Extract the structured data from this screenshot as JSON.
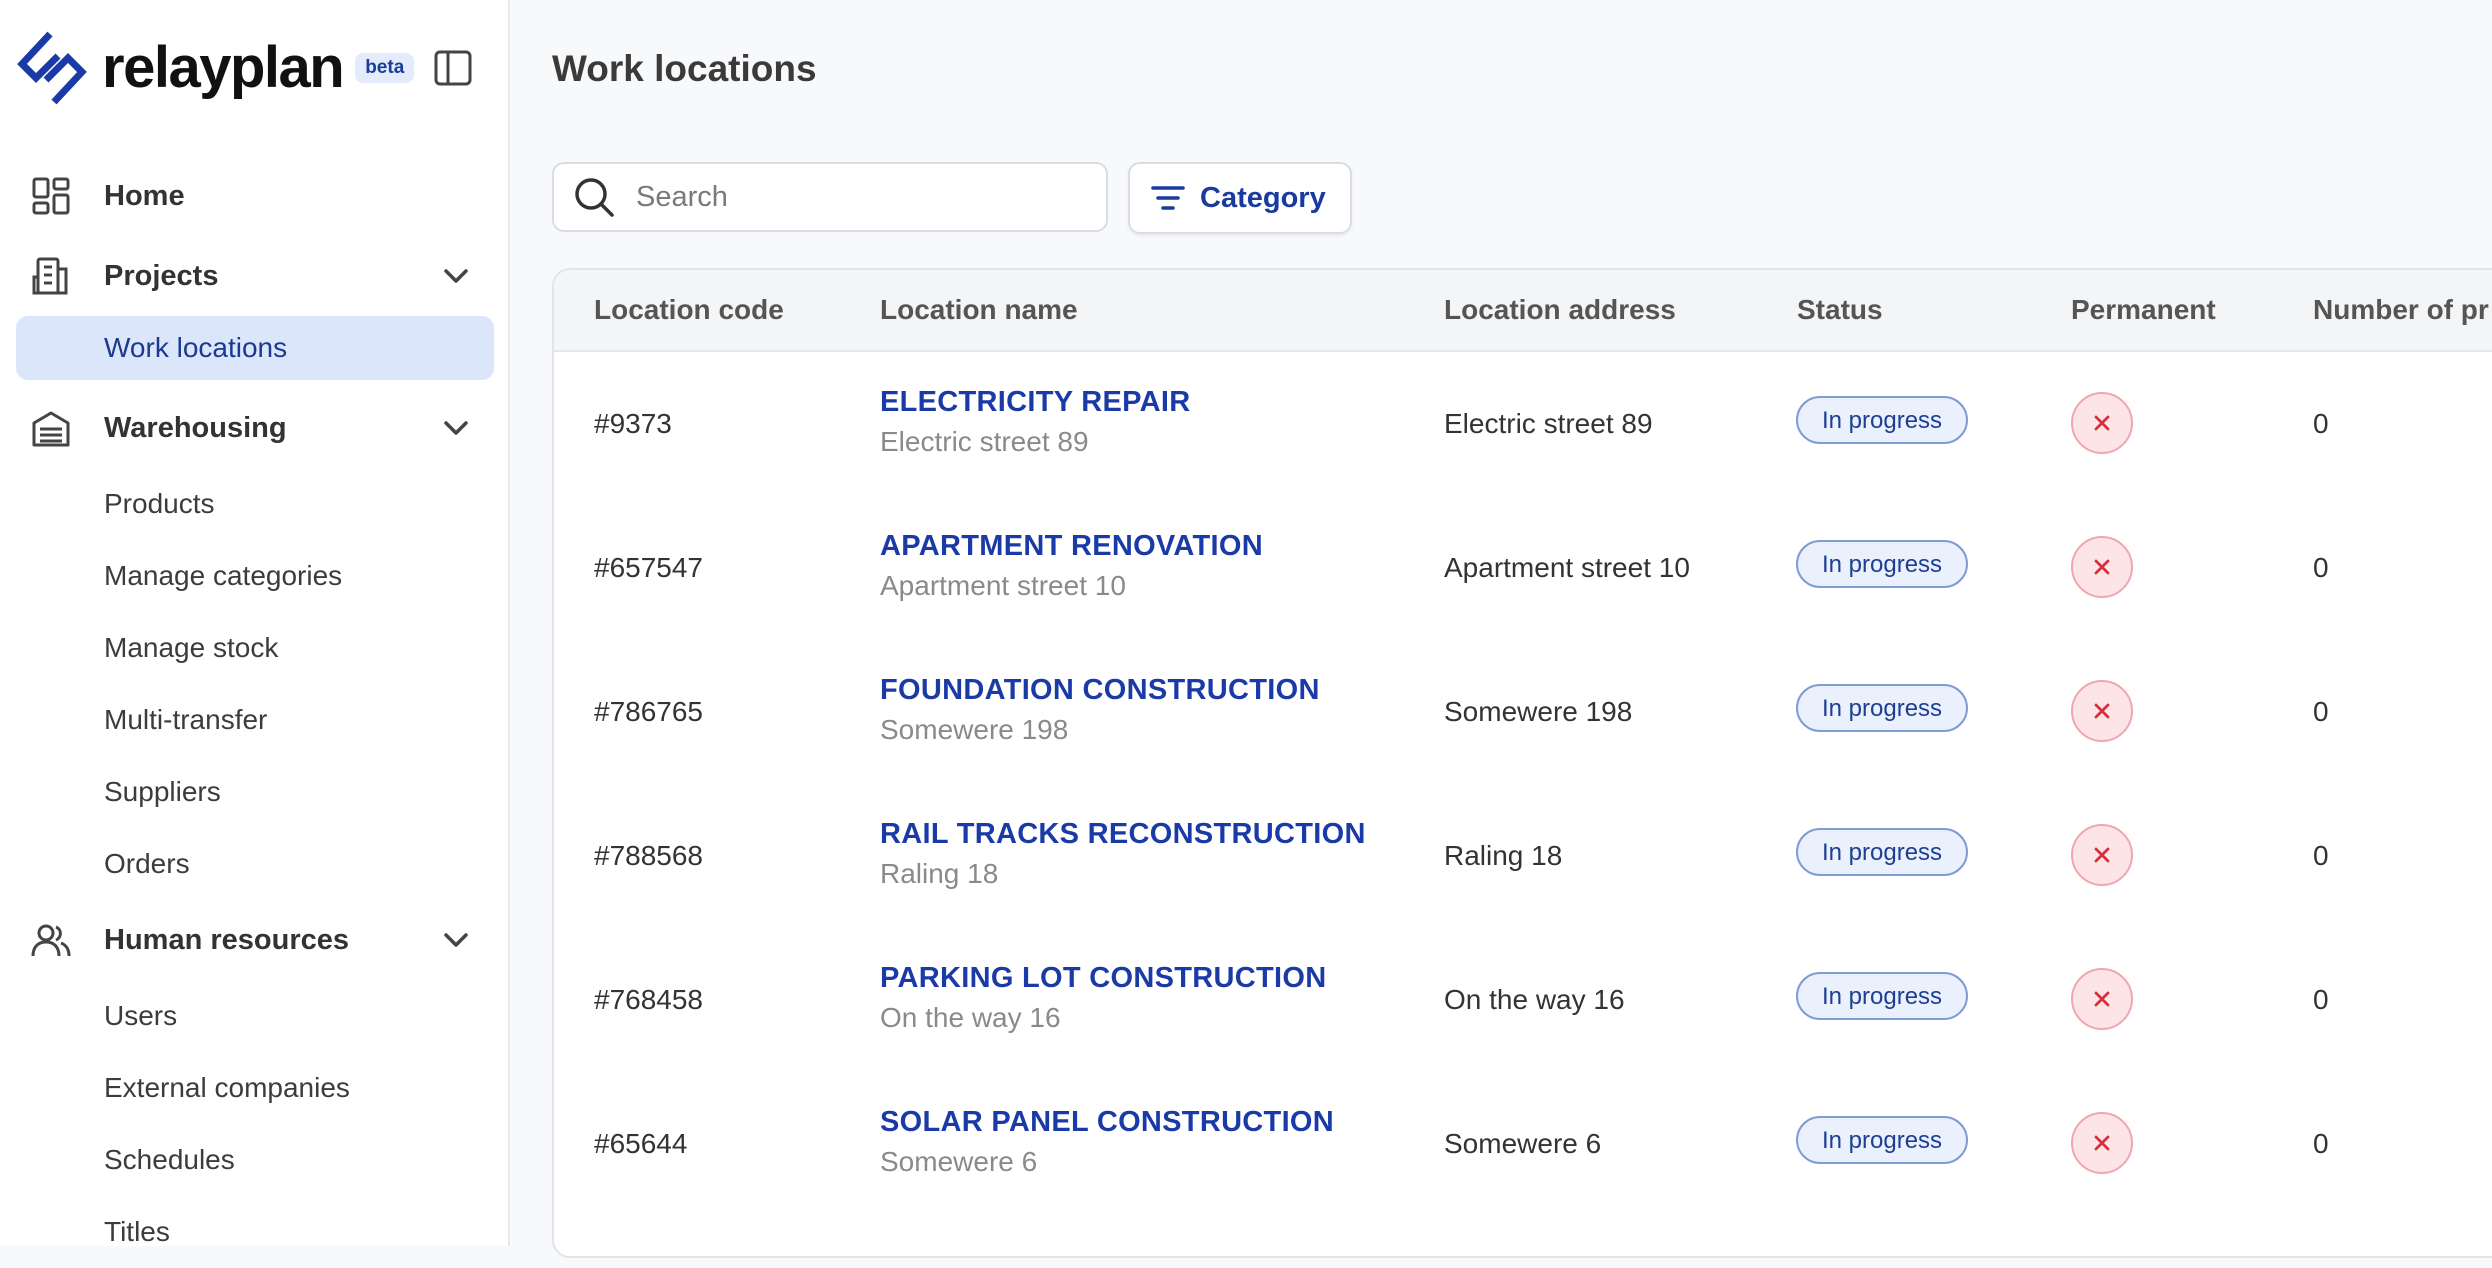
{
  "brand": {
    "name": "relayplan",
    "badge": "beta"
  },
  "sidebar": {
    "items": [
      {
        "label": "Home",
        "icon": "dashboard-icon"
      },
      {
        "label": "Projects",
        "icon": "building-icon",
        "children": [
          {
            "label": "Work locations",
            "active": true
          }
        ]
      },
      {
        "label": "Warehousing",
        "icon": "warehouse-icon",
        "children": [
          {
            "label": "Products"
          },
          {
            "label": "Manage categories"
          },
          {
            "label": "Manage stock"
          },
          {
            "label": "Multi-transfer"
          },
          {
            "label": "Suppliers"
          },
          {
            "label": "Orders"
          }
        ]
      },
      {
        "label": "Human resources",
        "icon": "users-icon",
        "children": [
          {
            "label": "Users"
          },
          {
            "label": "External companies"
          },
          {
            "label": "Schedules"
          },
          {
            "label": "Titles"
          }
        ]
      }
    ]
  },
  "main": {
    "title": "Work locations",
    "search": {
      "placeholder": "Search",
      "value": ""
    },
    "filter_label": "Category",
    "table": {
      "columns": [
        "Location code",
        "Location name",
        "Location address",
        "Status",
        "Permanent",
        "Number of pr"
      ],
      "rows": [
        {
          "code": "#9373",
          "name": "ELECTRICITY REPAIR",
          "sub": "Electric street 89",
          "address": "Electric street 89",
          "status": "In progress",
          "permanent": false,
          "count": "0"
        },
        {
          "code": "#657547",
          "name": "APARTMENT RENOVATION",
          "sub": "Apartment street 10",
          "address": "Apartment street 10",
          "status": "In progress",
          "permanent": false,
          "count": "0"
        },
        {
          "code": "#786765",
          "name": "FOUNDATION CONSTRUCTION",
          "sub": "Somewere 198",
          "address": "Somewere 198",
          "status": "In progress",
          "permanent": false,
          "count": "0"
        },
        {
          "code": "#788568",
          "name": "RAIL TRACKS RECONSTRUCTION",
          "sub": "Raling 18",
          "address": "Raling 18",
          "status": "In progress",
          "permanent": false,
          "count": "0"
        },
        {
          "code": "#768458",
          "name": "PARKING LOT CONSTRUCTION",
          "sub": "On the way 16",
          "address": "On the way 16",
          "status": "In progress",
          "permanent": false,
          "count": "0"
        },
        {
          "code": "#65644",
          "name": "SOLAR PANEL CONSTRUCTION",
          "sub": "Somewere 6",
          "address": "Somewere 6",
          "status": "In progress",
          "permanent": false,
          "count": "0"
        }
      ]
    }
  },
  "colors": {
    "accent": "#1a3aa8",
    "active_bg": "#dce6fb",
    "status_bg": "#eaf0fc",
    "danger_bg": "#fde5e7",
    "danger": "#d9303e"
  }
}
